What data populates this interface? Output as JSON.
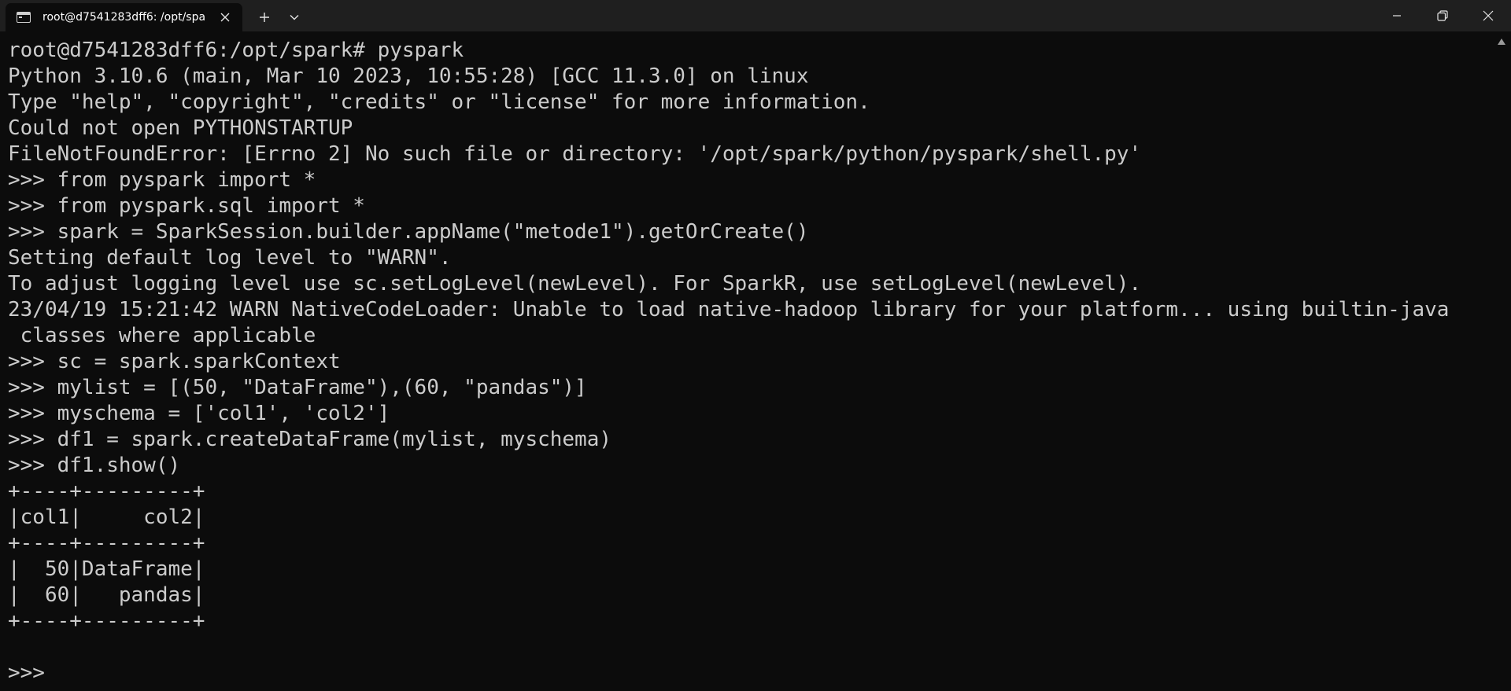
{
  "window": {
    "tab_title": "root@d7541283dff6: /opt/spa"
  },
  "icons": {
    "tab": "terminal-icon",
    "close_tab": "close-icon",
    "new_tab": "plus-icon",
    "dropdown": "chevron-down-icon",
    "minimize": "minimize-icon",
    "maximize": "restore-icon",
    "close_window": "close-icon",
    "scroll_up": "arrow-up-icon"
  },
  "colors": {
    "background": "#0c0c0c",
    "titlebar": "#1f1f1f",
    "text": "#cccccc"
  },
  "terminal": {
    "lines": [
      "root@d7541283dff6:/opt/spark# pyspark",
      "Python 3.10.6 (main, Mar 10 2023, 10:55:28) [GCC 11.3.0] on linux",
      "Type \"help\", \"copyright\", \"credits\" or \"license\" for more information.",
      "Could not open PYTHONSTARTUP",
      "FileNotFoundError: [Errno 2] No such file or directory: '/opt/spark/python/pyspark/shell.py'",
      ">>> from pyspark import *",
      ">>> from pyspark.sql import *",
      ">>> spark = SparkSession.builder.appName(\"metode1\").getOrCreate()",
      "Setting default log level to \"WARN\".",
      "To adjust logging level use sc.setLogLevel(newLevel). For SparkR, use setLogLevel(newLevel).",
      "23/04/19 15:21:42 WARN NativeCodeLoader: Unable to load native-hadoop library for your platform... using builtin-java",
      " classes where applicable",
      ">>> sc = spark.sparkContext",
      ">>> mylist = [(50, \"DataFrame\"),(60, \"pandas\")]",
      ">>> myschema = ['col1', 'col2']",
      ">>> df1 = spark.createDataFrame(mylist, myschema)",
      ">>> df1.show()",
      "+----+---------+",
      "|col1|     col2|",
      "+----+---------+",
      "|  50|DataFrame|",
      "|  60|   pandas|",
      "+----+---------+",
      "",
      ">>> "
    ]
  }
}
